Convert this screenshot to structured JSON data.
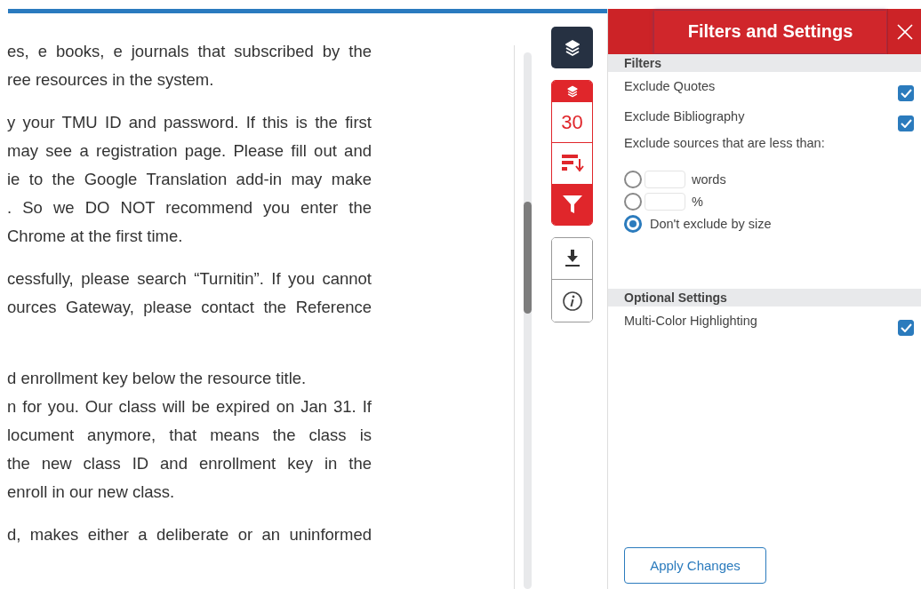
{
  "document": {
    "paragraphs": [
      {
        "lines": [
          {
            "text": "es, e books, e journals that subscribed by the",
            "justify": true
          },
          {
            "text": "ree resources in the system.",
            "justify": false
          }
        ]
      },
      {
        "lines": [
          {
            "text": "y your TMU ID and password. If this is the first",
            "justify": true
          },
          {
            "text": "may see a registration page. Please fill out and",
            "justify": true
          },
          {
            "text": "ie to the Google Translation add-in may make",
            "justify": true
          },
          {
            "text": ". So we DO NOT recommend you enter the",
            "justify": true
          },
          {
            "text": "Chrome at the first time.",
            "justify": false
          }
        ]
      },
      {
        "lines": [
          {
            "text": "cessfully, please search “Turnitin”. If you cannot",
            "justify": true
          },
          {
            "text": "ources Gateway, please contact the Reference",
            "justify": true
          }
        ]
      },
      {
        "lines": [
          {
            "text": "d enrollment key below the resource title.",
            "justify": false
          },
          {
            "text": "n for you. Our class will be expired on Jan 31. If",
            "justify": true
          },
          {
            "text": "locument anymore, that means the class is",
            "justify": true
          },
          {
            "text": "the new class ID and enrollment key in the",
            "justify": true
          },
          {
            "text": "enroll in our new class.",
            "justify": false
          }
        ]
      },
      {
        "lines": [
          {
            "text": "d, makes either a deliberate or an uninformed",
            "justify": true
          }
        ]
      }
    ]
  },
  "toolbar": {
    "match_count": "30"
  },
  "panel": {
    "title": "Filters and Settings",
    "sections": [
      {
        "title": "Filters",
        "items": [
          {
            "kind": "checkbox",
            "label": "Exclude Quotes",
            "checked": true
          },
          {
            "kind": "checkbox",
            "label": "Exclude Bibliography",
            "checked": true
          },
          {
            "kind": "text",
            "label": "Exclude sources that are less than:"
          },
          {
            "kind": "radio",
            "label": "words",
            "selected": false,
            "has_field": true
          },
          {
            "kind": "radio",
            "label": "%",
            "selected": false,
            "has_field": true
          },
          {
            "kind": "radio",
            "label": "Don't exclude by size",
            "selected": true,
            "has_field": false
          }
        ]
      },
      {
        "title": "Optional Settings",
        "items": [
          {
            "kind": "checkbox",
            "label": "Multi-Color Highlighting",
            "checked": true
          }
        ]
      }
    ],
    "apply_button": "Apply Changes"
  }
}
